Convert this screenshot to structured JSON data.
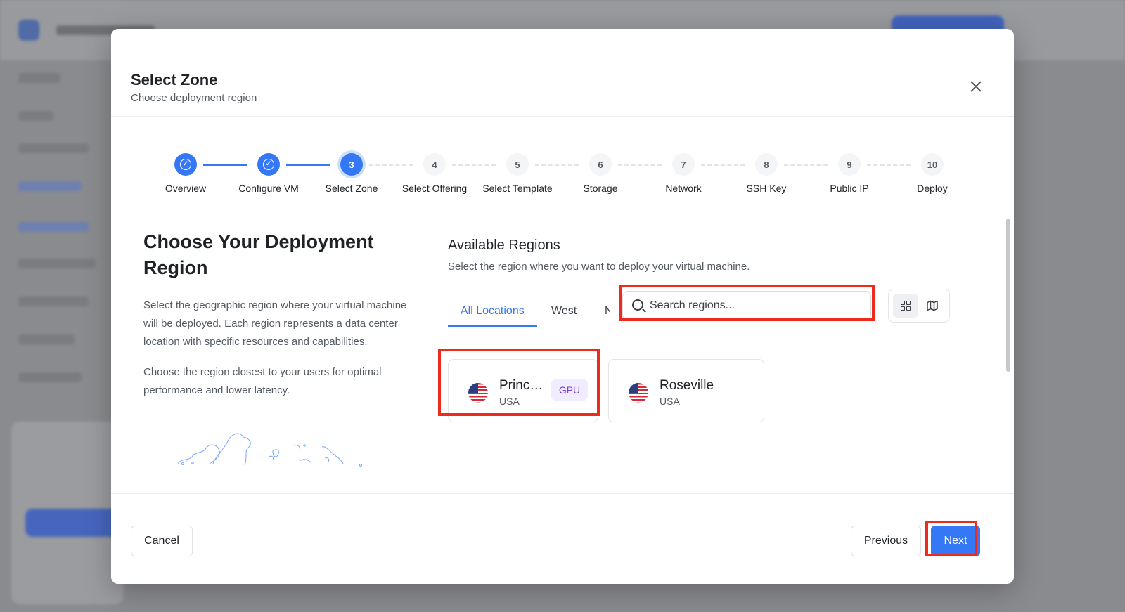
{
  "modal": {
    "title": "Select Zone",
    "subtitle": "Choose deployment region"
  },
  "steps": [
    {
      "number": "✓",
      "label": "Overview",
      "state": "done"
    },
    {
      "number": "✓",
      "label": "Configure VM",
      "state": "done"
    },
    {
      "number": "3",
      "label": "Select Zone",
      "state": "current"
    },
    {
      "number": "4",
      "label": "Select Offering",
      "state": "pending"
    },
    {
      "number": "5",
      "label": "Select Template",
      "state": "pending"
    },
    {
      "number": "6",
      "label": "Storage",
      "state": "pending"
    },
    {
      "number": "7",
      "label": "Network",
      "state": "pending"
    },
    {
      "number": "8",
      "label": "SSH Key",
      "state": "pending"
    },
    {
      "number": "9",
      "label": "Public IP",
      "state": "pending"
    },
    {
      "number": "10",
      "label": "Deploy",
      "state": "pending"
    }
  ],
  "intro": {
    "heading": "Choose Your Deployment Region",
    "paragraph1": "Select the geographic region where your virtual machine will be deployed. Each region represents a data center location with specific resources and capabilities.",
    "paragraph2": "Choose the region closest to your users for optimal performance and lower latency."
  },
  "regions_panel": {
    "title": "Available Regions",
    "subtitle": "Select the region where you want to deploy your virtual machine.",
    "tabs": [
      "All Locations",
      "West",
      "N"
    ],
    "active_tab": "All Locations",
    "search": {
      "placeholder": "Search regions...",
      "value": ""
    },
    "view_modes": [
      "grid-icon",
      "map-icon"
    ]
  },
  "regions": [
    {
      "name": "Princ…",
      "country": "USA",
      "badge": "GPU",
      "flag": "us-flag-icon"
    },
    {
      "name": "Roseville",
      "country": "USA",
      "flag": "us-flag-icon"
    }
  ],
  "footer": {
    "cancel_label": "Cancel",
    "previous_label": "Previous",
    "next_label": "Next"
  },
  "colors": {
    "accent": "#3478f6",
    "highlight": "#ee2a1c",
    "gpu_badge_text": "#7b3fcf",
    "gpu_badge_bg": "#f1ecff"
  }
}
